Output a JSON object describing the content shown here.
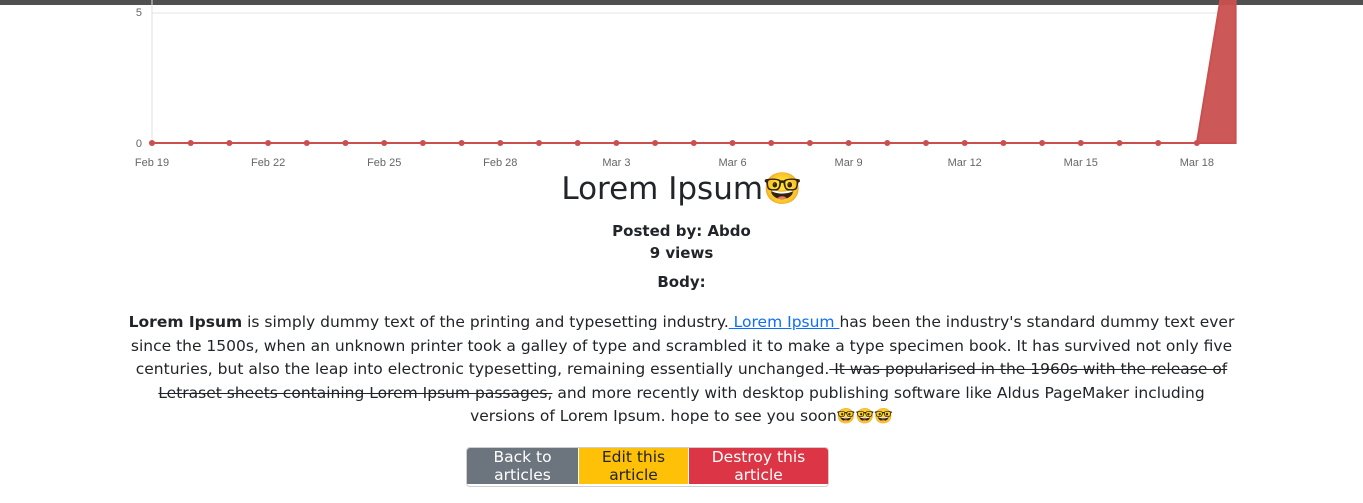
{
  "chart_data": {
    "type": "area",
    "x": [
      "Feb 19",
      "Feb 20",
      "Feb 21",
      "Feb 22",
      "Feb 23",
      "Feb 24",
      "Feb 25",
      "Feb 26",
      "Feb 27",
      "Feb 28",
      "Mar 1",
      "Mar 2",
      "Mar 3",
      "Mar 4",
      "Mar 5",
      "Mar 6",
      "Mar 7",
      "Mar 8",
      "Mar 9",
      "Mar 10",
      "Mar 11",
      "Mar 12",
      "Mar 13",
      "Mar 14",
      "Mar 15",
      "Mar 16",
      "Mar 17",
      "Mar 18",
      "Mar 19"
    ],
    "values": [
      0,
      0,
      0,
      0,
      0,
      0,
      0,
      0,
      0,
      0,
      0,
      0,
      0,
      0,
      0,
      0,
      0,
      0,
      0,
      0,
      0,
      0,
      0,
      0,
      0,
      0,
      0,
      0,
      9
    ],
    "xticks": [
      "Feb 19",
      "Feb 22",
      "Feb 25",
      "Feb 28",
      "Mar 3",
      "Mar 6",
      "Mar 9",
      "Mar 12",
      "Mar 15",
      "Mar 18"
    ],
    "yticks": [
      "0",
      "5"
    ],
    "ylim": [
      0,
      10
    ],
    "color": "#c9504f",
    "grid": true
  },
  "article": {
    "title": "Lorem Ipsum",
    "title_emoji": "🤓",
    "posted_by": "Posted by: Abdo",
    "views": "9 views",
    "body_label": "Body:",
    "body_bold": "Lorem Ipsum",
    "body_part1": " is simply dummy text of the printing and typesetting industry.",
    "body_link": " Lorem Ipsum ",
    "body_part2": "has been the industry's standard dummy text ever since the 1500s, when an unknown printer took a galley of type and scrambled it to make a type specimen book. It has survived not only five centuries, but also the leap into electronic typesetting, remaining essentially unchanged.",
    "body_strike": " It was popularised in the 1960s with the release of Letraset sheets containing Lorem Ipsum passages,",
    "body_part3": " and more recently with desktop publishing software like Aldus PageMaker including versions of Lorem Ipsum. hope to see you soon",
    "body_emojis": "🤓🤓🤓"
  },
  "actions": {
    "back": "Back to articles",
    "edit": "Edit this article",
    "destroy": "Destroy this article"
  }
}
